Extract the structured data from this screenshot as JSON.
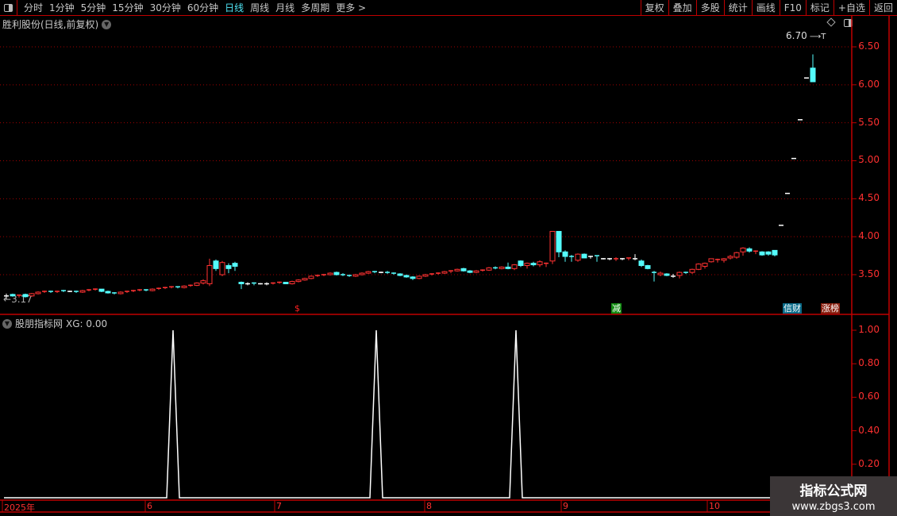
{
  "toolbar": {
    "periods": [
      "分时",
      "1分钟",
      "5分钟",
      "15分钟",
      "30分钟",
      "60分钟",
      "日线",
      "周线",
      "月线",
      "多周期",
      "更多 >"
    ],
    "active_period": "日线",
    "actions": [
      "复权",
      "叠加",
      "多股",
      "统计",
      "画线",
      "F10",
      "标记",
      "+自选",
      "返回"
    ]
  },
  "main": {
    "title": "胜利股份(日线,前复权)",
    "y_ticks": [
      "6.50",
      "6.00",
      "5.50",
      "5.00",
      "4.50",
      "4.00",
      "3.50"
    ],
    "high_label": "6.70",
    "low_label": "3.17",
    "markers": [
      {
        "text": "$",
        "index": 46,
        "color": "#ff2020",
        "bg": ""
      },
      {
        "text": "减",
        "index": 96,
        "color": "#ffffff",
        "bg": "#108a10"
      },
      {
        "text": "信财",
        "index": 123,
        "color": "#ffffff",
        "bg": "#0a6c8a"
      },
      {
        "text": "涨榜",
        "index": 129,
        "color": "#ffffff",
        "bg": "#8a2010"
      }
    ]
  },
  "indicator": {
    "title": "股朋指标网",
    "value_label": "XG: 0.00",
    "y_ticks": [
      "1.00",
      "0.80",
      "0.60",
      "0.40",
      "0.20"
    ],
    "signal_indices": [
      26,
      58,
      80
    ]
  },
  "dates": {
    "labels": [
      "2025年",
      "6",
      "7",
      "8",
      "9",
      "10"
    ]
  },
  "watermark": {
    "line1": "指标公式网",
    "line2": "www.zbgs3.com"
  },
  "colors": {
    "up": "#ff3232",
    "down": "#54fcfc",
    "grid": "#c00000",
    "axis_text": "#ff3030"
  },
  "chart_data": {
    "type": "candlestick",
    "y_ticks": [
      3.5,
      4.0,
      4.5,
      5.0,
      5.5,
      6.0,
      6.5
    ],
    "candles": [
      [
        3.22,
        3.25,
        3.18,
        3.22
      ],
      [
        3.24,
        3.25,
        3.21,
        3.22
      ],
      [
        3.22,
        3.24,
        3.2,
        3.23
      ],
      [
        3.24,
        3.25,
        3.2,
        3.21
      ],
      [
        3.22,
        3.26,
        3.21,
        3.25
      ],
      [
        3.25,
        3.28,
        3.24,
        3.27
      ],
      [
        3.27,
        3.29,
        3.26,
        3.28
      ],
      [
        3.28,
        3.29,
        3.26,
        3.27
      ],
      [
        3.27,
        3.29,
        3.26,
        3.28
      ],
      [
        3.29,
        3.3,
        3.27,
        3.28
      ],
      [
        3.28,
        3.29,
        3.27,
        3.28
      ],
      [
        3.28,
        3.29,
        3.26,
        3.27
      ],
      [
        3.27,
        3.3,
        3.26,
        3.29
      ],
      [
        3.29,
        3.31,
        3.28,
        3.3
      ],
      [
        3.3,
        3.32,
        3.29,
        3.31
      ],
      [
        3.31,
        3.31,
        3.27,
        3.28
      ],
      [
        3.28,
        3.29,
        3.25,
        3.26
      ],
      [
        3.26,
        3.27,
        3.24,
        3.25
      ],
      [
        3.25,
        3.28,
        3.24,
        3.27
      ],
      [
        3.27,
        3.29,
        3.26,
        3.28
      ],
      [
        3.28,
        3.3,
        3.27,
        3.29
      ],
      [
        3.29,
        3.31,
        3.28,
        3.3
      ],
      [
        3.3,
        3.31,
        3.28,
        3.29
      ],
      [
        3.29,
        3.32,
        3.28,
        3.31
      ],
      [
        3.31,
        3.33,
        3.3,
        3.32
      ],
      [
        3.32,
        3.34,
        3.31,
        3.33
      ],
      [
        3.33,
        3.35,
        3.32,
        3.34
      ],
      [
        3.34,
        3.35,
        3.32,
        3.33
      ],
      [
        3.33,
        3.36,
        3.32,
        3.35
      ],
      [
        3.35,
        3.37,
        3.34,
        3.36
      ],
      [
        3.36,
        3.4,
        3.35,
        3.39
      ],
      [
        3.39,
        3.44,
        3.37,
        3.42
      ],
      [
        3.38,
        3.71,
        3.35,
        3.62
      ],
      [
        3.68,
        3.7,
        3.55,
        3.58
      ],
      [
        3.5,
        3.68,
        3.48,
        3.66
      ],
      [
        3.62,
        3.65,
        3.52,
        3.58
      ],
      [
        3.65,
        3.67,
        3.55,
        3.61
      ],
      [
        3.4,
        3.41,
        3.31,
        3.38
      ],
      [
        3.38,
        3.4,
        3.36,
        3.38
      ],
      [
        3.39,
        3.4,
        3.36,
        3.38
      ],
      [
        3.38,
        3.39,
        3.37,
        3.38
      ],
      [
        3.38,
        3.4,
        3.36,
        3.38
      ],
      [
        3.38,
        3.4,
        3.37,
        3.39
      ],
      [
        3.39,
        3.41,
        3.38,
        3.4
      ],
      [
        3.4,
        3.4,
        3.38,
        3.38
      ],
      [
        3.38,
        3.42,
        3.37,
        3.41
      ],
      [
        3.41,
        3.44,
        3.4,
        3.43
      ],
      [
        3.43,
        3.46,
        3.42,
        3.45
      ],
      [
        3.45,
        3.49,
        3.44,
        3.48
      ],
      [
        3.48,
        3.5,
        3.47,
        3.49
      ],
      [
        3.49,
        3.51,
        3.48,
        3.5
      ],
      [
        3.5,
        3.53,
        3.49,
        3.52
      ],
      [
        3.53,
        3.54,
        3.49,
        3.5
      ],
      [
        3.5,
        3.52,
        3.48,
        3.49
      ],
      [
        3.49,
        3.5,
        3.47,
        3.48
      ],
      [
        3.48,
        3.51,
        3.47,
        3.5
      ],
      [
        3.5,
        3.53,
        3.49,
        3.52
      ],
      [
        3.52,
        3.55,
        3.51,
        3.54
      ],
      [
        3.54,
        3.55,
        3.52,
        3.53
      ],
      [
        3.53,
        3.54,
        3.52,
        3.53
      ],
      [
        3.53,
        3.55,
        3.51,
        3.52
      ],
      [
        3.52,
        3.53,
        3.5,
        3.51
      ],
      [
        3.51,
        3.52,
        3.48,
        3.49
      ],
      [
        3.49,
        3.5,
        3.46,
        3.47
      ],
      [
        3.47,
        3.48,
        3.43,
        3.45
      ],
      [
        3.45,
        3.49,
        3.44,
        3.48
      ],
      [
        3.48,
        3.51,
        3.47,
        3.5
      ],
      [
        3.5,
        3.52,
        3.49,
        3.51
      ],
      [
        3.51,
        3.53,
        3.5,
        3.52
      ],
      [
        3.52,
        3.55,
        3.51,
        3.54
      ],
      [
        3.54,
        3.56,
        3.52,
        3.55
      ],
      [
        3.55,
        3.58,
        3.54,
        3.57
      ],
      [
        3.58,
        3.59,
        3.54,
        3.55
      ],
      [
        3.55,
        3.56,
        3.52,
        3.53
      ],
      [
        3.53,
        3.56,
        3.52,
        3.55
      ],
      [
        3.55,
        3.57,
        3.54,
        3.56
      ],
      [
        3.56,
        3.6,
        3.55,
        3.59
      ],
      [
        3.59,
        3.61,
        3.57,
        3.58
      ],
      [
        3.58,
        3.61,
        3.57,
        3.6
      ],
      [
        3.6,
        3.66,
        3.57,
        3.58
      ],
      [
        3.58,
        3.64,
        3.56,
        3.63
      ],
      [
        3.68,
        3.69,
        3.6,
        3.62
      ],
      [
        3.62,
        3.66,
        3.58,
        3.65
      ],
      [
        3.65,
        3.67,
        3.61,
        3.63
      ],
      [
        3.63,
        3.69,
        3.6,
        3.67
      ],
      [
        3.64,
        3.66,
        3.6,
        3.65
      ],
      [
        3.68,
        4.07,
        3.64,
        4.07
      ],
      [
        4.07,
        4.07,
        3.73,
        3.8
      ],
      [
        3.8,
        3.82,
        3.67,
        3.74
      ],
      [
        3.74,
        3.76,
        3.67,
        3.73
      ],
      [
        3.69,
        3.78,
        3.67,
        3.77
      ],
      [
        3.77,
        3.78,
        3.72,
        3.72
      ],
      [
        3.74,
        3.75,
        3.71,
        3.74
      ],
      [
        3.75,
        3.75,
        3.67,
        3.74
      ],
      [
        3.71,
        3.72,
        3.7,
        3.71
      ],
      [
        3.71,
        3.72,
        3.69,
        3.71
      ],
      [
        3.7,
        3.73,
        3.68,
        3.71
      ],
      [
        3.71,
        3.72,
        3.69,
        3.71
      ],
      [
        3.71,
        3.72,
        3.69,
        3.72
      ],
      [
        3.71,
        3.77,
        3.69,
        3.71
      ],
      [
        3.68,
        3.7,
        3.6,
        3.62
      ],
      [
        3.62,
        3.63,
        3.57,
        3.58
      ],
      [
        3.53,
        3.55,
        3.41,
        3.52
      ],
      [
        3.5,
        3.54,
        3.48,
        3.52
      ],
      [
        3.51,
        3.52,
        3.48,
        3.49
      ],
      [
        3.48,
        3.51,
        3.46,
        3.48
      ],
      [
        3.49,
        3.54,
        3.45,
        3.53
      ],
      [
        3.53,
        3.54,
        3.51,
        3.52
      ],
      [
        3.53,
        3.58,
        3.51,
        3.57
      ],
      [
        3.57,
        3.65,
        3.56,
        3.64
      ],
      [
        3.61,
        3.66,
        3.58,
        3.65
      ],
      [
        3.67,
        3.71,
        3.66,
        3.71
      ],
      [
        3.69,
        3.71,
        3.66,
        3.7
      ],
      [
        3.69,
        3.72,
        3.66,
        3.71
      ],
      [
        3.72,
        3.76,
        3.7,
        3.74
      ],
      [
        3.73,
        3.8,
        3.71,
        3.79
      ],
      [
        3.8,
        3.86,
        3.75,
        3.85
      ],
      [
        3.84,
        3.86,
        3.79,
        3.81
      ],
      [
        3.8,
        3.82,
        3.77,
        3.81
      ],
      [
        3.8,
        3.81,
        3.75,
        3.76
      ],
      [
        3.8,
        3.81,
        3.75,
        3.77
      ],
      [
        3.82,
        3.82,
        3.74,
        3.76
      ],
      [
        4.15,
        4.15,
        4.15,
        4.15
      ],
      [
        4.57,
        4.57,
        4.57,
        4.57
      ],
      [
        5.03,
        5.03,
        5.03,
        5.03
      ],
      [
        5.54,
        5.54,
        5.54,
        5.54
      ],
      [
        6.09,
        6.09,
        6.09,
        6.09
      ],
      [
        6.22,
        6.4,
        6.04,
        6.04
      ]
    ]
  }
}
